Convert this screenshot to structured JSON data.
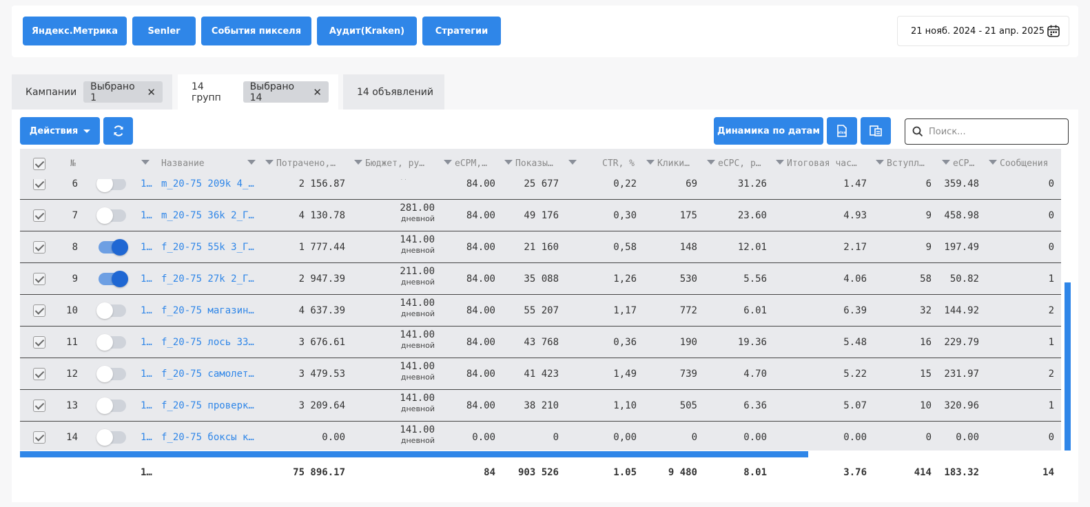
{
  "topbar": {
    "buttons": [
      "Яндекс.Метрика",
      "Senler",
      "События пикселя",
      "Аудит(Kraken)",
      "Стратегии"
    ],
    "date_range": "21 нояб. 2024 - 21 апр. 2025"
  },
  "tabs": {
    "campaigns": {
      "label": "Кампании",
      "chip": "Выбрано 1"
    },
    "groups": {
      "label": "14 групп",
      "chip": "Выбрано 14"
    },
    "ads": {
      "label": "14 объявлений"
    }
  },
  "toolbar": {
    "actions_label": "Действия",
    "dynamics_label": "Динамика по датам",
    "search_placeholder": "Поиск..."
  },
  "table": {
    "headers": {
      "num": "№",
      "name": "Название",
      "spent": "Потрачено,…",
      "budget": "Бюджет, ру…",
      "ecpm": "eCPM,…",
      "shows": "Показы…",
      "ctr": "CTR, %",
      "clicks": "Клики…",
      "ecpc": "eCPC, р…",
      "freq": "Итоговая час…",
      "joins": "Вступл…",
      "ecpj": "eCP…",
      "msgs": "Сообщения"
    },
    "rows": [
      {
        "n": "6",
        "id": "1…",
        "name": "m_20-75 209k 4_…",
        "spent": "2 156.87",
        "budget": "",
        "budget_sub": "дневной",
        "ecpm": "84.00",
        "shows": "25 677",
        "ctr": "0,22",
        "clicks": "69",
        "ecpc": "31.26",
        "freq": "1.47",
        "joins": "6",
        "ecpj": "359.48",
        "msgs": "0",
        "on": false
      },
      {
        "n": "7",
        "id": "1…",
        "name": "m_20-75 36k 2_Г…",
        "spent": "4 130.78",
        "budget": "281.00",
        "budget_sub": "дневной",
        "ecpm": "84.00",
        "shows": "49 176",
        "ctr": "0,30",
        "clicks": "175",
        "ecpc": "23.60",
        "freq": "4.93",
        "joins": "9",
        "ecpj": "458.98",
        "msgs": "0",
        "on": false
      },
      {
        "n": "8",
        "id": "1…",
        "name": "f_20-75 55k 3_Г…",
        "spent": "1 777.44",
        "budget": "141.00",
        "budget_sub": "дневной",
        "ecpm": "84.00",
        "shows": "21 160",
        "ctr": "0,58",
        "clicks": "148",
        "ecpc": "12.01",
        "freq": "2.17",
        "joins": "9",
        "ecpj": "197.49",
        "msgs": "0",
        "on": true
      },
      {
        "n": "9",
        "id": "1…",
        "name": "f_20-75 27k 2_Г…",
        "spent": "2 947.39",
        "budget": "211.00",
        "budget_sub": "дневной",
        "ecpm": "84.00",
        "shows": "35 088",
        "ctr": "1,26",
        "clicks": "530",
        "ecpc": "5.56",
        "freq": "4.06",
        "joins": "58",
        "ecpj": "50.82",
        "msgs": "1",
        "on": true
      },
      {
        "n": "10",
        "id": "1…",
        "name": "f_20-75 магазин…",
        "spent": "4 637.39",
        "budget": "141.00",
        "budget_sub": "дневной",
        "ecpm": "84.00",
        "shows": "55 207",
        "ctr": "1,17",
        "clicks": "772",
        "ecpc": "6.01",
        "freq": "6.39",
        "joins": "32",
        "ecpj": "144.92",
        "msgs": "2",
        "on": false
      },
      {
        "n": "11",
        "id": "1…",
        "name": "f_20-75 лось 33…",
        "spent": "3 676.61",
        "budget": "141.00",
        "budget_sub": "дневной",
        "ecpm": "84.00",
        "shows": "43 768",
        "ctr": "0,36",
        "clicks": "190",
        "ecpc": "19.36",
        "freq": "5.48",
        "joins": "16",
        "ecpj": "229.79",
        "msgs": "1",
        "on": false
      },
      {
        "n": "12",
        "id": "1…",
        "name": "f_20-75 самолет…",
        "spent": "3 479.53",
        "budget": "141.00",
        "budget_sub": "дневной",
        "ecpm": "84.00",
        "shows": "41 423",
        "ctr": "1,49",
        "clicks": "739",
        "ecpc": "4.70",
        "freq": "5.22",
        "joins": "15",
        "ecpj": "231.97",
        "msgs": "2",
        "on": false
      },
      {
        "n": "13",
        "id": "1…",
        "name": "f_20-75 проверк…",
        "spent": "3 209.64",
        "budget": "141.00",
        "budget_sub": "дневной",
        "ecpm": "84.00",
        "shows": "38 210",
        "ctr": "1,10",
        "clicks": "505",
        "ecpc": "6.36",
        "freq": "5.07",
        "joins": "10",
        "ecpj": "320.96",
        "msgs": "1",
        "on": false
      },
      {
        "n": "14",
        "id": "1…",
        "name": "f_20-75 боксы к…",
        "spent": "0.00",
        "budget": "141.00",
        "budget_sub": "дневной",
        "ecpm": "0.00",
        "shows": "0",
        "ctr": "0,00",
        "clicks": "0",
        "ecpc": "0.00",
        "freq": "0.00",
        "joins": "0",
        "ecpj": "0.00",
        "msgs": "0",
        "on": false
      }
    ],
    "totals": {
      "id": "1…",
      "spent": "75 896.17",
      "ecpm": "84",
      "shows": "903 526",
      "ctr": "1.05",
      "clicks": "9 480",
      "ecpc": "8.01",
      "freq": "3.76",
      "joins": "414",
      "ecpj": "183.32",
      "msgs": "14"
    }
  },
  "colors": {
    "accent": "#2f86e8",
    "toggle_on": "#1f67d3"
  }
}
